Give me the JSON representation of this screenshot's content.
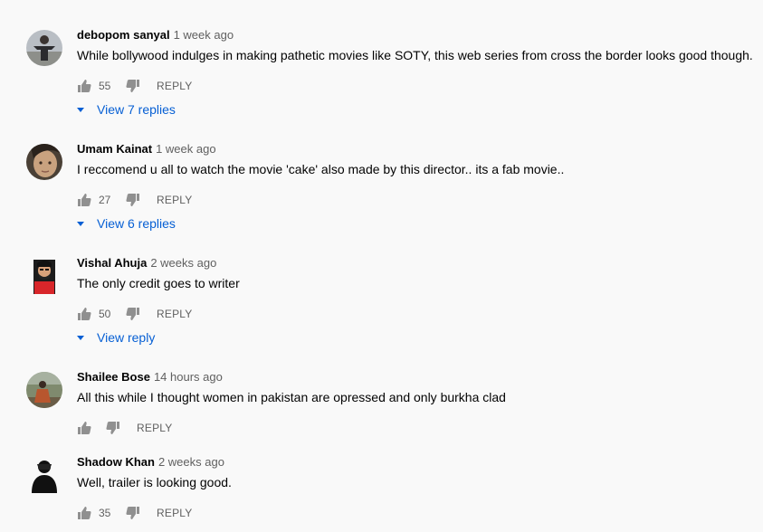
{
  "comments": [
    {
      "author": "debopom sanyal",
      "time": "1 week ago",
      "text": "While bollywood indulges in making pathetic movies like SOTY, this web series from cross the border looks good though.",
      "likes": "55",
      "reply_label": "REPLY",
      "view_replies": "View 7 replies",
      "avatar_icon": "person-standing-avatar"
    },
    {
      "author": "Umam Kainat",
      "time": "1 week ago",
      "text": "I reccomend u all to watch the movie 'cake' also made by this director.. its a fab movie..",
      "likes": "27",
      "reply_label": "REPLY",
      "view_replies": "View 6 replies",
      "avatar_icon": "face-avatar"
    },
    {
      "author": "Vishal Ahuja",
      "time": "2 weeks ago",
      "text": "The only credit goes to writer",
      "likes": "50",
      "reply_label": "REPLY",
      "view_replies": "View reply",
      "avatar_icon": "cartoon-man-avatar"
    },
    {
      "author": "Shailee Bose",
      "time": "14 hours ago",
      "text": "All this while I thought women in pakistan are opressed and only burkha clad",
      "likes": "",
      "reply_label": "REPLY",
      "avatar_icon": "woman-outdoor-avatar"
    },
    {
      "author": "Shadow Khan",
      "time": "2 weeks ago",
      "text": "Well, trailer is looking good.",
      "likes": "35",
      "reply_label": "REPLY",
      "avatar_icon": "silhouette-avatar"
    }
  ],
  "colors": {
    "link": "#065fd4",
    "meta": "#606060",
    "text": "#030303",
    "background": "#f9f9f9"
  }
}
